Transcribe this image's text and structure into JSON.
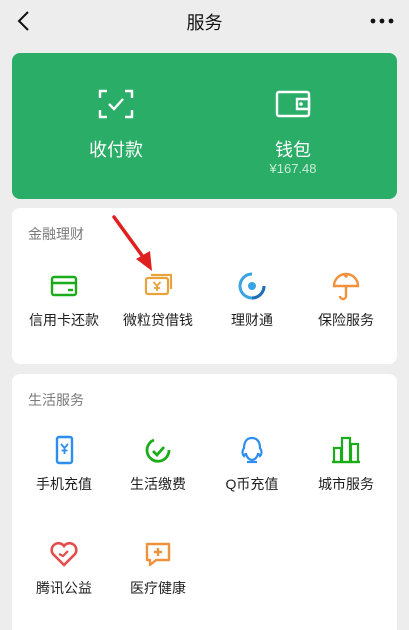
{
  "header": {
    "title": "服务",
    "back_icon": "chevron-left-icon",
    "more_icon": "more-dots-icon"
  },
  "wallet": {
    "collect_pay_label": "收付款",
    "wallet_label": "钱包",
    "wallet_balance": "¥167.48",
    "accent": "#2aae67"
  },
  "finance": {
    "title": "金融理财",
    "items": [
      {
        "label": "信用卡还款",
        "icon": "credit-card-icon",
        "color": "#1aad19"
      },
      {
        "label": "微粒贷借钱",
        "icon": "loan-money-icon",
        "color": "#e8a33a"
      },
      {
        "label": "理财通",
        "icon": "wealth-icon",
        "color": "#3aa3e3"
      },
      {
        "label": "保险服务",
        "icon": "insurance-umbrella-icon",
        "color": "#f0913c"
      }
    ]
  },
  "life": {
    "title": "生活服务",
    "items": [
      {
        "label": "手机充值",
        "icon": "phone-topup-icon",
        "color": "#2d8ef0"
      },
      {
        "label": "生活缴费",
        "icon": "bill-payment-icon",
        "color": "#1aad19"
      },
      {
        "label": "Q币充值",
        "icon": "qq-coin-icon",
        "color": "#2d8ef0"
      },
      {
        "label": "城市服务",
        "icon": "city-service-icon",
        "color": "#1aad19"
      },
      {
        "label": "腾讯公益",
        "icon": "charity-heart-icon",
        "color": "#e54d4d"
      },
      {
        "label": "医疗健康",
        "icon": "medical-health-icon",
        "color": "#f0913c"
      }
    ]
  },
  "annotation": {
    "arrow_color": "#e02020"
  }
}
